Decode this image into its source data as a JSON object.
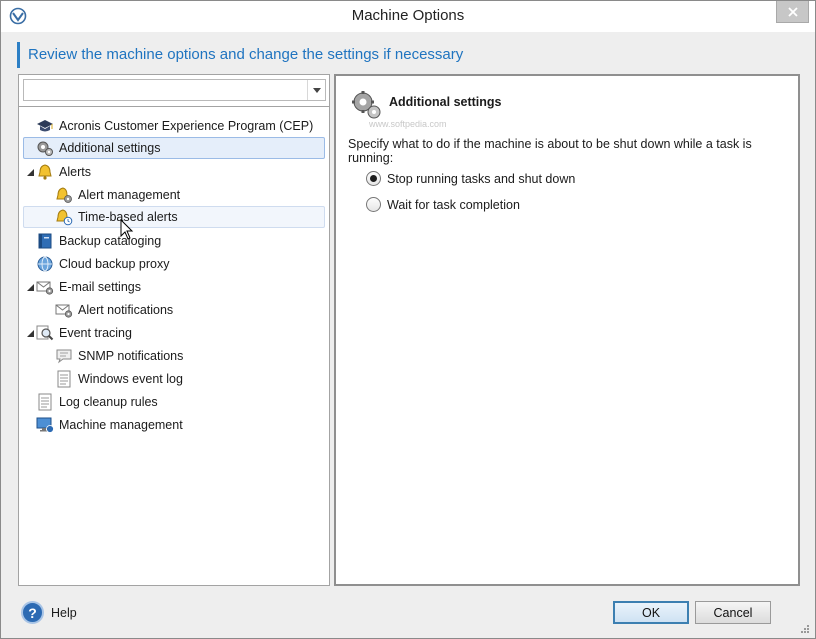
{
  "window": {
    "title": "Machine Options",
    "close_icon": "close-icon"
  },
  "header": {
    "text": "Review the machine options and change the settings if necessary"
  },
  "filter": {
    "value": "",
    "placeholder": ""
  },
  "tree": {
    "items": [
      {
        "label": "Acronis Customer Experience Program (CEP)",
        "icon": "graduation-cap-icon",
        "level": 0
      },
      {
        "label": "Additional settings",
        "icon": "gears-icon",
        "level": 0,
        "selected": true
      },
      {
        "label": "Alerts",
        "icon": "bell-icon",
        "level": 0,
        "expanded": true
      },
      {
        "label": "Alert management",
        "icon": "bell-gear-icon",
        "level": 1
      },
      {
        "label": "Time-based alerts",
        "icon": "bell-clock-icon",
        "level": 1
      },
      {
        "label": "Backup cataloging",
        "icon": "catalog-book-icon",
        "level": 0
      },
      {
        "label": "Cloud backup proxy",
        "icon": "globe-icon",
        "level": 0
      },
      {
        "label": "E-mail settings",
        "icon": "envelope-gear-icon",
        "level": 0,
        "expanded": true
      },
      {
        "label": "Alert notifications",
        "icon": "envelope-gear-icon",
        "level": 1
      },
      {
        "label": "Event tracing",
        "icon": "magnifier-icon",
        "level": 0,
        "expanded": true
      },
      {
        "label": "SNMP notifications",
        "icon": "speech-bubble-icon",
        "level": 1
      },
      {
        "label": "Windows event log",
        "icon": "log-page-icon",
        "level": 1
      },
      {
        "label": "Log cleanup rules",
        "icon": "log-page-icon",
        "level": 0
      },
      {
        "label": "Machine management",
        "icon": "monitor-icon",
        "level": 0
      }
    ]
  },
  "detail": {
    "title": "Additional settings",
    "watermark": "www.softpedia.com",
    "description": "Specify what to do if the machine is about to be shut down while a task is running:",
    "options": [
      {
        "label": "Stop running tasks and shut down",
        "checked": true
      },
      {
        "label": "Wait for task completion",
        "checked": false
      }
    ]
  },
  "footer": {
    "help_label": "Help",
    "ok_label": "OK",
    "cancel_label": "Cancel"
  },
  "colors": {
    "accent": "#1f74c0",
    "selection": "#e5eefa"
  }
}
